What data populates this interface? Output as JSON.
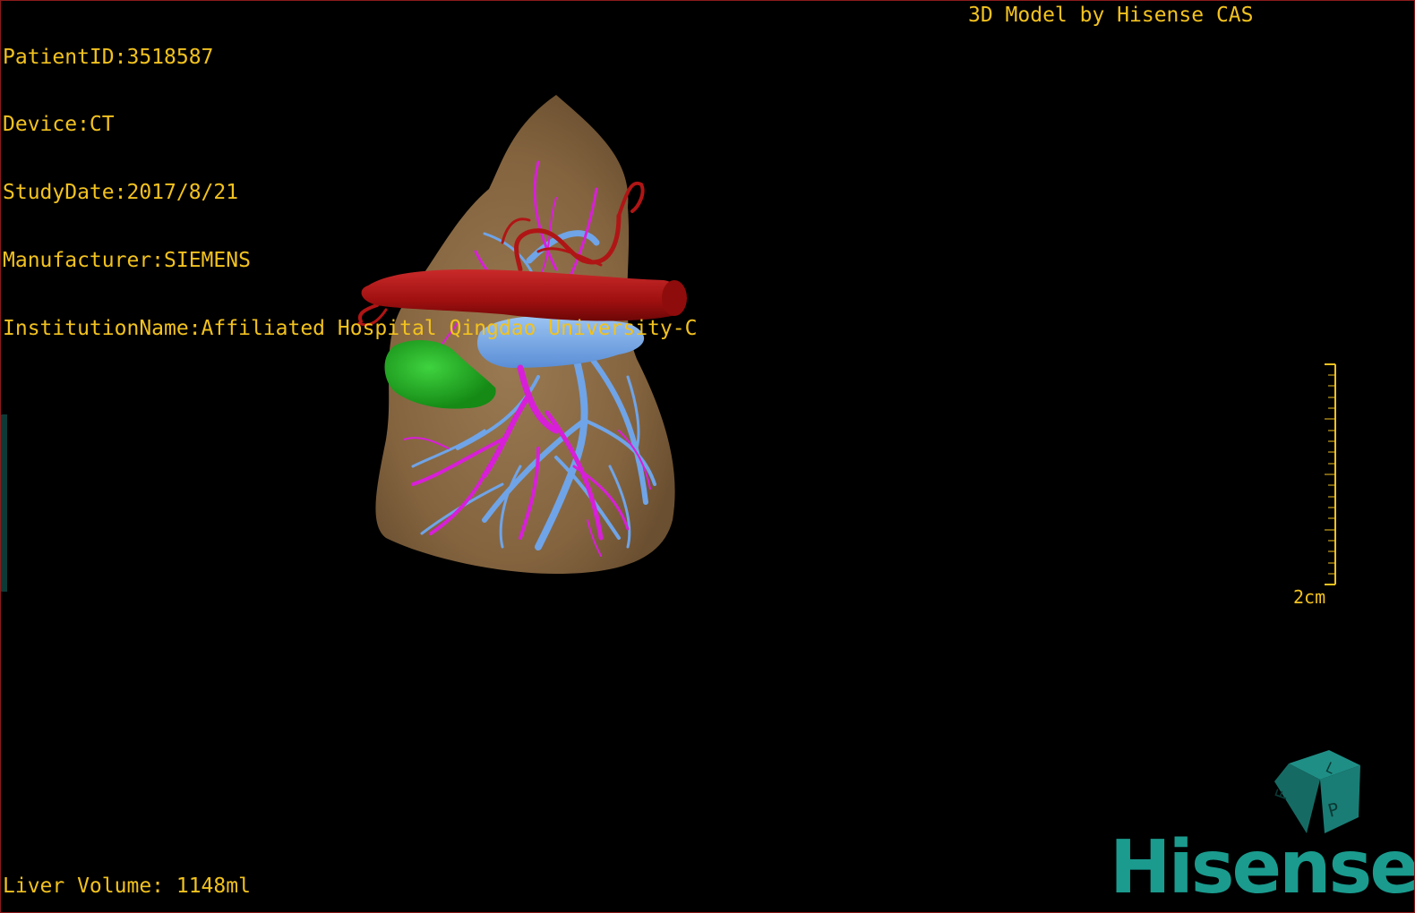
{
  "header": {
    "patient_id": "PatientID:3518587",
    "device": "Device:CT",
    "study_date": "StudyDate:2017/8/21",
    "manufacturer": "Manufacturer:SIEMENS",
    "institution": "InstitutionName:Affiliated Hospital Qingdao University-C"
  },
  "brand_title": "3D Model by Hisense CAS",
  "footer": {
    "liver_volume": "Liver Volume: 1148ml"
  },
  "scale_bar": {
    "label": "2cm"
  },
  "orientation_cube": {
    "face_front": "P",
    "face_left": "F",
    "face_top": "L"
  },
  "logo": {
    "text": "Hisense"
  },
  "colors": {
    "overlay_text": "#f2c21f",
    "liver": "#8b6a45",
    "artery": "#b01515",
    "portal_vein": "#d81fd8",
    "hepatic_vein": "#6fa4e8",
    "gallbladder": "#1fae1f",
    "brand": "#1a9b8e"
  },
  "icons": [
    "orientation-cube-icon",
    "hisense-logo"
  ]
}
